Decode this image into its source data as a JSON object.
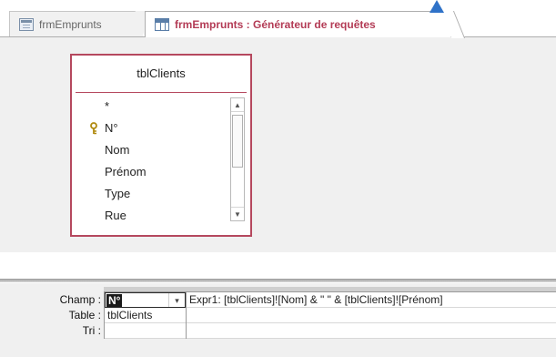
{
  "tabs": [
    {
      "label": "frmEmprunts",
      "icon": "form-icon",
      "active": false
    },
    {
      "label": "frmEmprunts : Générateur de requêtes",
      "icon": "query-icon",
      "active": true
    }
  ],
  "table": {
    "name": "tblClients",
    "fields": [
      "*",
      "N°",
      "Nom",
      "Prénom",
      "Type",
      "Rue"
    ],
    "primary_key_field": "N°"
  },
  "grid": {
    "row_labels": {
      "champ": "Champ :",
      "table": "Table :",
      "tri": "Tri :"
    },
    "columns": [
      {
        "field": "N°",
        "table": "tblClients",
        "sort": ""
      },
      {
        "field": "Expr1: [tblClients]![Nom] & \" \" & [tblClients]![Prénom]",
        "table": "",
        "sort": ""
      }
    ]
  },
  "colors": {
    "active_tab_text": "#b33b55",
    "table_border": "#b5485e",
    "marker": "#2f72c8"
  }
}
